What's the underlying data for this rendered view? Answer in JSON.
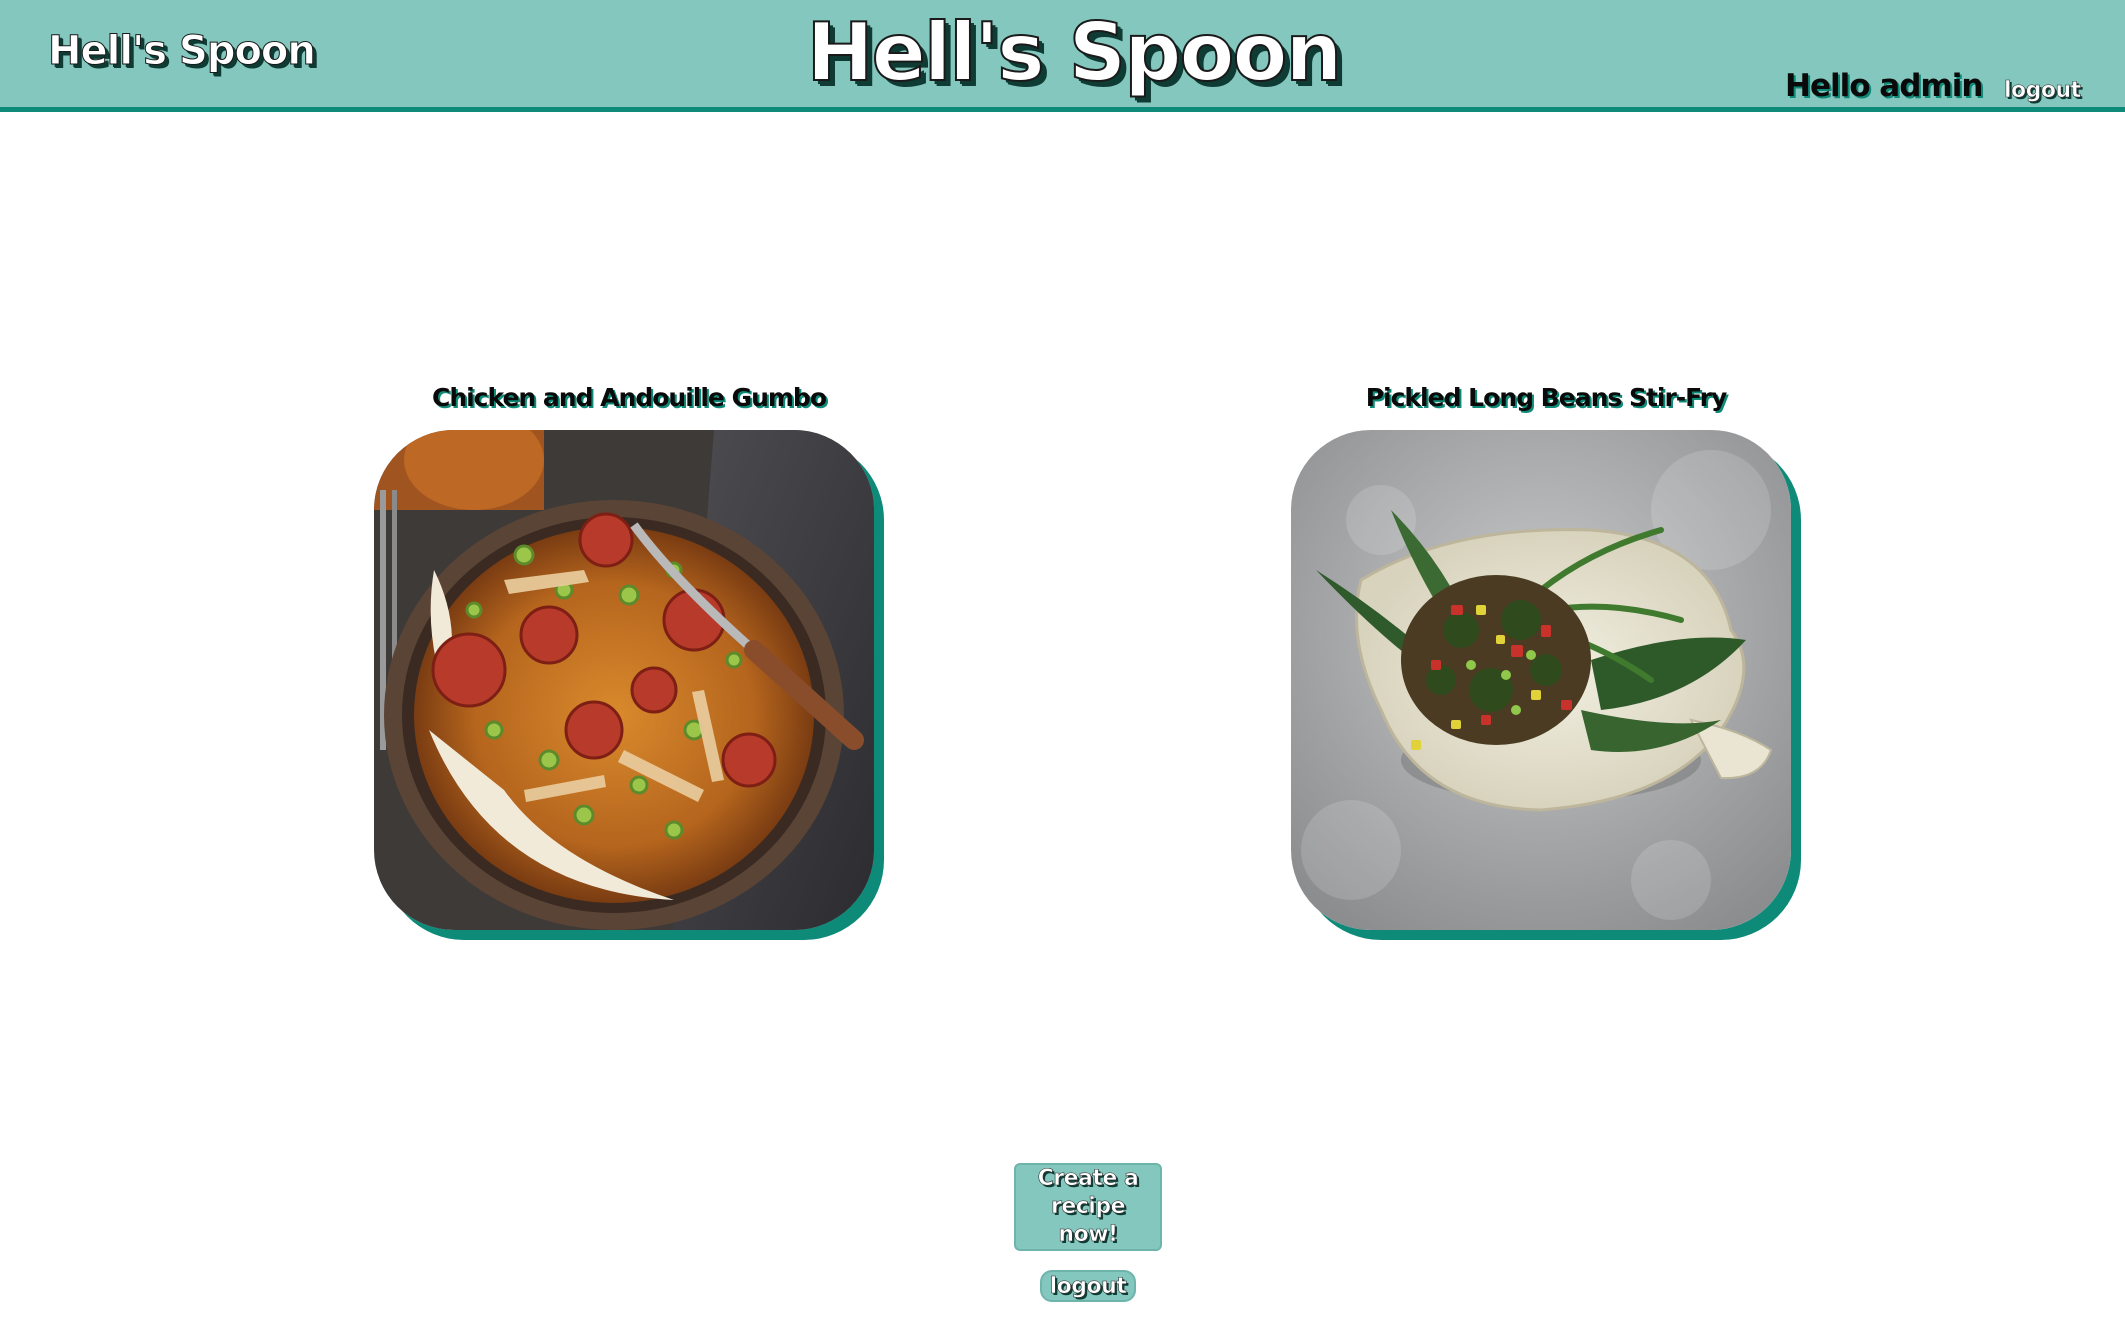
{
  "header": {
    "brand_small": "Hell's Spoon",
    "brand_large": "Hell's Spoon",
    "greeting": "Hello admin",
    "logout_label": "logout"
  },
  "recipes": [
    {
      "title": "Chicken and Andouille Gumbo",
      "image": "gumbo-photo"
    },
    {
      "title": "Pickled Long Beans Stir-Fry",
      "image": "stir-fry-photo"
    }
  ],
  "actions": {
    "create_label": "Create a recipe now!",
    "logout_label": "logout"
  },
  "colors": {
    "header_bg": "#84c7be",
    "accent": "#0e8a78",
    "button_bg": "#84c7be"
  }
}
